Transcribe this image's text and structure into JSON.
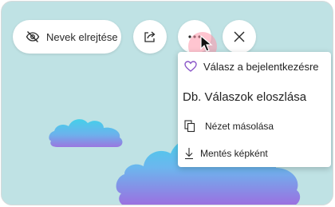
{
  "toolbar": {
    "hide_names_label": "Nevek elrejtése"
  },
  "icons": {
    "hide": "eye-off-icon",
    "share": "share-icon",
    "more": "more-horizontal-icon",
    "close": "close-icon",
    "heart": "heart-icon",
    "copy": "copy-icon",
    "download": "download-icon"
  },
  "menu": {
    "items": [
      {
        "label": "Válasz a bejelentkezésre"
      },
      {
        "label": "Db. Válaszok eloszlása"
      },
      {
        "label": "Nézet másolása"
      },
      {
        "label": "Mentés képként"
      }
    ]
  },
  "colors": {
    "background": "#bfe2e4",
    "heart_accent": "#8a56c8",
    "click_highlight": "#ff96aa"
  }
}
